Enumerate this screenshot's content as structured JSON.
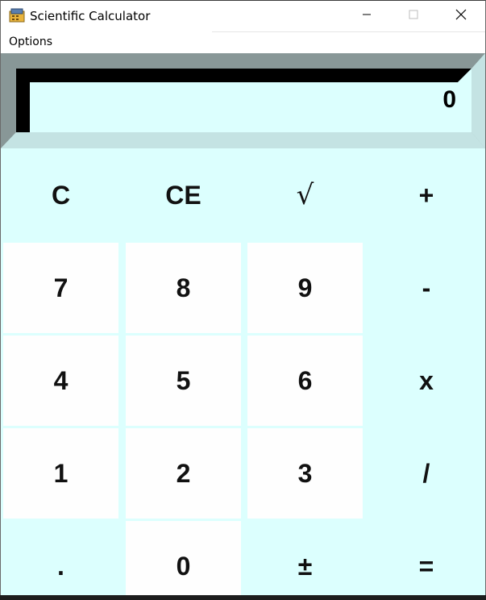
{
  "window": {
    "title": "Scientific Calculator",
    "icon": "calculator-app-icon"
  },
  "menu": {
    "items": [
      {
        "label": "Options"
      }
    ]
  },
  "display": {
    "value": "0"
  },
  "keypad": {
    "rows": [
      [
        {
          "label": "C"
        },
        {
          "label": "CE"
        },
        {
          "label": "√"
        },
        {
          "label": "+"
        }
      ],
      [
        {
          "label": "7"
        },
        {
          "label": "8"
        },
        {
          "label": "9"
        },
        {
          "label": "-"
        }
      ],
      [
        {
          "label": "4"
        },
        {
          "label": "5"
        },
        {
          "label": "6"
        },
        {
          "label": "x"
        }
      ],
      [
        {
          "label": "1"
        },
        {
          "label": "2"
        },
        {
          "label": "3"
        },
        {
          "label": "/"
        }
      ],
      [
        {
          "label": "."
        },
        {
          "label": "0"
        },
        {
          "label": "±"
        },
        {
          "label": "="
        }
      ]
    ]
  },
  "colors": {
    "keypad_background": "#dcfffe",
    "number_key": "#fefefe",
    "display_background": "#dcfffe",
    "bezel_dark": "#889797",
    "bezel_light": "#c4e3e3",
    "bezel_black": "#000000"
  }
}
